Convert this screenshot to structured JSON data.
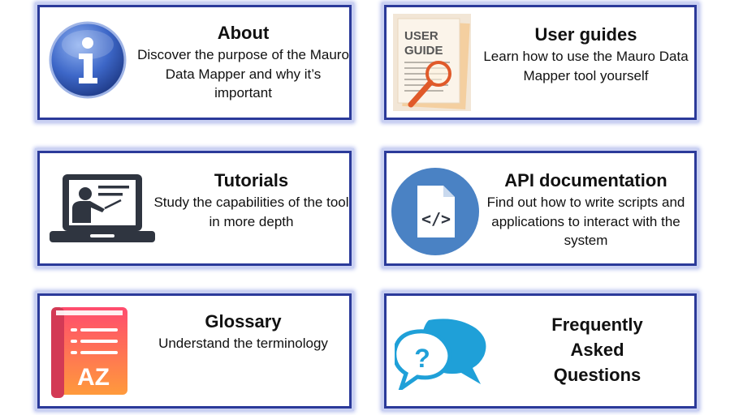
{
  "cards": [
    {
      "title": "About",
      "description": "Discover the purpose of the Mauro Data Mapper and why it’s important",
      "icon": "info-icon"
    },
    {
      "title": "User guides",
      "description": "Learn how to use the Mauro Data Mapper tool yourself",
      "icon": "user-guide-icon",
      "icon_text": "USER GUIDE"
    },
    {
      "title": "Tutorials",
      "description": "Study the capabilities of the tool in more depth",
      "icon": "laptop-presentation-icon"
    },
    {
      "title": "API documentation",
      "description": "Find out how to write scripts and applications to interact with the system",
      "icon": "code-file-icon"
    },
    {
      "title": "Glossary",
      "description": "Understand the terminology",
      "icon": "glossary-book-icon",
      "icon_text": "AZ"
    },
    {
      "title": "Frequently Asked Questions",
      "description": "",
      "icon": "faq-speech-bubbles-icon"
    }
  ],
  "colors": {
    "border": "#2b3a9a",
    "glow": "#aab4ea",
    "info_blue": "#3d67c8",
    "code_circle": "#4a82c4",
    "book_top": "#ff4b6e",
    "book_bottom": "#ff9a3c",
    "bubble": "#1fa0d8"
  }
}
